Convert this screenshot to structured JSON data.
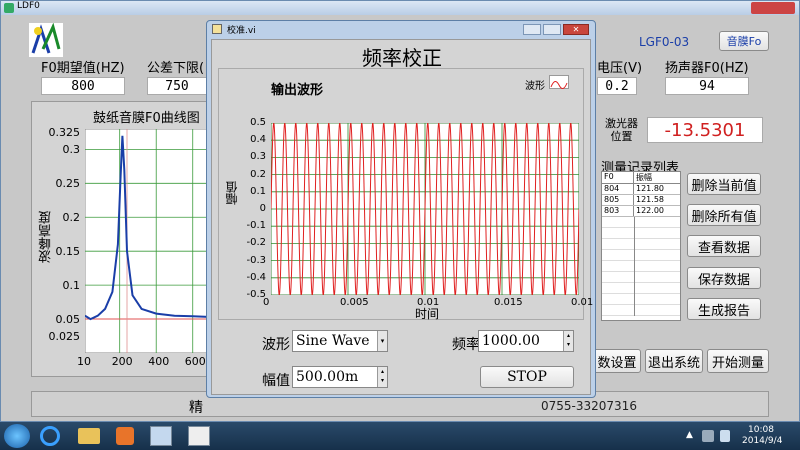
{
  "main_window": {
    "title": "LDF0",
    "header_code": "LGF0-03",
    "header_button": "音膜Fo",
    "fields": [
      {
        "label": "F0期望值(HZ)",
        "value": "800"
      },
      {
        "label": "公差下限(",
        "value": "750"
      },
      {
        "label": "电压(V)",
        "value": "0.2"
      },
      {
        "label": "扬声器F0(HZ)",
        "value": "94"
      }
    ],
    "curve_title": "鼓纸音膜F0曲线图",
    "curve_ylabel": "波峰高度",
    "curve_yticks": [
      "0.325",
      "0.3",
      "0.25",
      "0.2",
      "0.15",
      "0.1",
      "0.05",
      "0.025"
    ],
    "curve_xticks": [
      "10",
      "200",
      "400",
      "600"
    ],
    "laser_label": "激光器\n位置",
    "laser_value": "-13.5301",
    "record_title": "测量记录列表",
    "record_headers": [
      "F0",
      "振幅"
    ],
    "record_rows": [
      [
        "804",
        "121.80"
      ],
      [
        "805",
        "121.58"
      ],
      [
        "803",
        "122.00"
      ]
    ],
    "side_buttons": [
      "删除当前值",
      "删除所有值",
      "查看数据",
      "保存数据",
      "生成报告"
    ],
    "bottom_buttons": [
      "数设置",
      "退出系统",
      "开始测量"
    ],
    "footer_left": "精",
    "footer_phone": "0755-33207316"
  },
  "dialog": {
    "title": "校准.vi",
    "heading": "频率校正",
    "graph_title": "输出波形",
    "legend_label": "波形",
    "ylabel": "幅值",
    "xlabel": "时间",
    "waveform_label": "波形",
    "waveform_value": "Sine Wave",
    "freq_label": "频率",
    "freq_value": "1000.00",
    "amp_label": "幅值",
    "amp_value": "500.00m",
    "stop_label": "STOP",
    "colors": {
      "wave": "#e02020",
      "grid": "#2e8b2e",
      "bg": "#ffffff"
    }
  },
  "chart_data": [
    {
      "type": "line",
      "title": "输出波形",
      "xlabel": "时间",
      "ylabel": "幅值",
      "xlim": [
        0,
        0.01
      ],
      "ylim": [
        -0.5,
        0.5
      ],
      "xticks": [
        "0",
        "0.005",
        "0.01",
        "0.015",
        "0.01"
      ],
      "yticks": [
        "0.5",
        "0.4",
        "0.3",
        "0.2",
        "0.1",
        "0",
        "-0.1",
        "-0.2",
        "-0.3",
        "-0.4",
        "-0.5"
      ],
      "series": [
        {
          "name": "波形",
          "function": "sine",
          "amplitude": 0.5,
          "cycles": 28
        }
      ],
      "grid": true
    },
    {
      "type": "line",
      "title": "鼓纸音膜F0曲线图",
      "ylabel": "波峰高度",
      "xlim": [
        10,
        700
      ],
      "ylim": [
        0,
        0.33
      ],
      "series": [
        {
          "x": [
            10,
            40,
            80,
            120,
            160,
            190,
            205,
            215,
            225,
            240,
            270,
            320,
            400,
            500,
            600,
            700
          ],
          "values": [
            0.055,
            0.05,
            0.055,
            0.065,
            0.09,
            0.16,
            0.26,
            0.32,
            0.27,
            0.15,
            0.085,
            0.065,
            0.058,
            0.055,
            0.054,
            0.053
          ]
        }
      ],
      "grid": true
    }
  ],
  "taskbar": {
    "time": "10:08",
    "date": "2014/9/4"
  }
}
